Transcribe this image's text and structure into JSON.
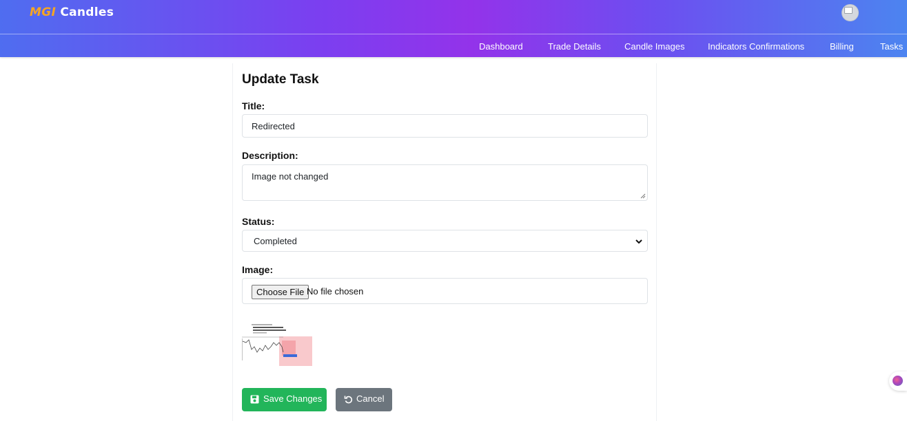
{
  "app": {
    "logo_part1": "MGI",
    "logo_part2": "Candles"
  },
  "colors": {
    "header_start": "#4f6df0",
    "header_mid": "#9333ea",
    "header_end": "#4c84f0",
    "save": "#22b55a",
    "cancel": "#6c757d",
    "logo_accent": "#f5a524"
  },
  "nav": {
    "items": [
      {
        "label": "Dashboard"
      },
      {
        "label": "Trade Details"
      },
      {
        "label": "Candle Images"
      },
      {
        "label": "Indicators Confirmations"
      },
      {
        "label": "Billing"
      },
      {
        "label": "Tasks"
      }
    ]
  },
  "form": {
    "heading": "Update Task",
    "title_label": "Title:",
    "title_value": "Redirected",
    "description_label": "Description:",
    "description_value": "Image not changed",
    "status_label": "Status:",
    "status_value": "Completed",
    "image_label": "Image:",
    "file_button": "Choose File",
    "file_status": "No file chosen",
    "save_label": "Save Changes",
    "cancel_label": "Cancel"
  },
  "icons": {
    "save": "floppy-disk-icon",
    "cancel": "undo-icon",
    "select": "chevron-down-icon",
    "assistant": "brain-icon"
  }
}
